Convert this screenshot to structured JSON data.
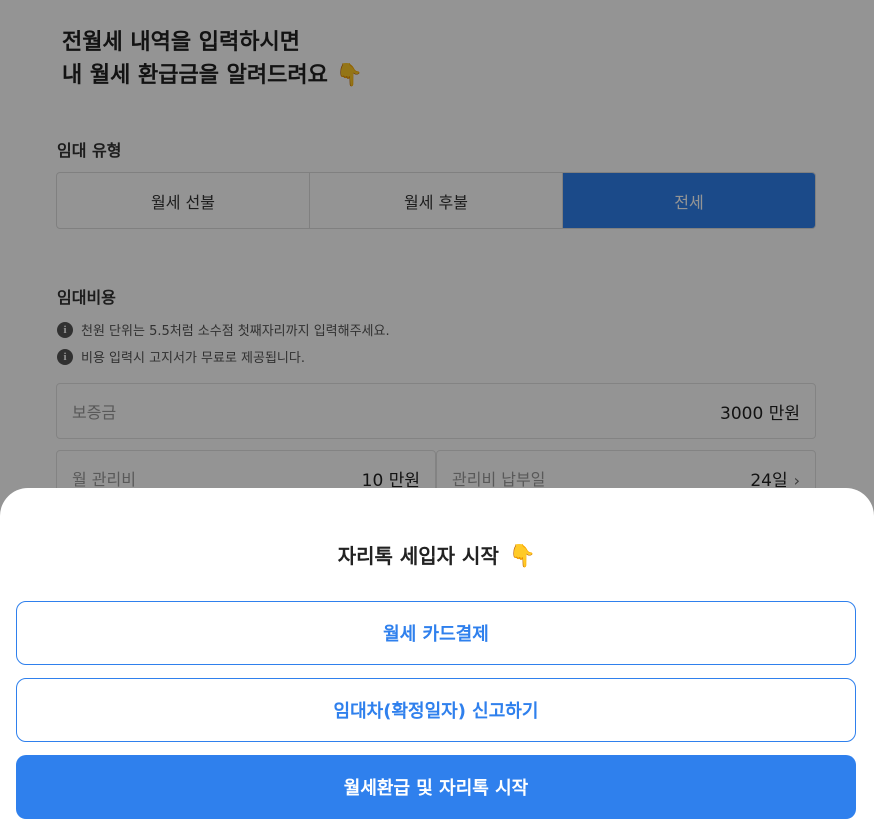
{
  "headline": {
    "line1": "전월세 내역을 입력하시면",
    "line2": "내 월세 환급금을 알려드려요",
    "emoji": "👇"
  },
  "lease_type": {
    "label": "임대 유형",
    "options": [
      "월세 선불",
      "월세 후불",
      "전세"
    ],
    "selected": "전세"
  },
  "cost": {
    "label": "임대비용",
    "notices": [
      "천원 단위는 5.5처럼 소수점 첫째자리까지 입력해주세요.",
      "비용 입력시 고지서가 무료로 제공됩니다."
    ],
    "deposit": {
      "label": "보증금",
      "value": "3000 만원"
    },
    "monthly_fee": {
      "label": "월 관리비",
      "value": "10 만원"
    },
    "due_day": {
      "label": "관리비 납부일",
      "value": "24일"
    }
  },
  "sheet": {
    "title": "자리톡 세입자 시작",
    "emoji": "👇",
    "buttons": {
      "card_payment": "월세 카드결제",
      "lease_report": "임대차(확정일자) 신고하기",
      "start": "월세환급 및 자리톡 시작"
    }
  },
  "colors": {
    "accent": "#2f80ed",
    "overlay": "rgba(0,0,0,0.42)"
  },
  "icons": {
    "info": "info-icon",
    "chevron": "chevron-right-icon",
    "pointing": "pointing-down-emoji"
  }
}
